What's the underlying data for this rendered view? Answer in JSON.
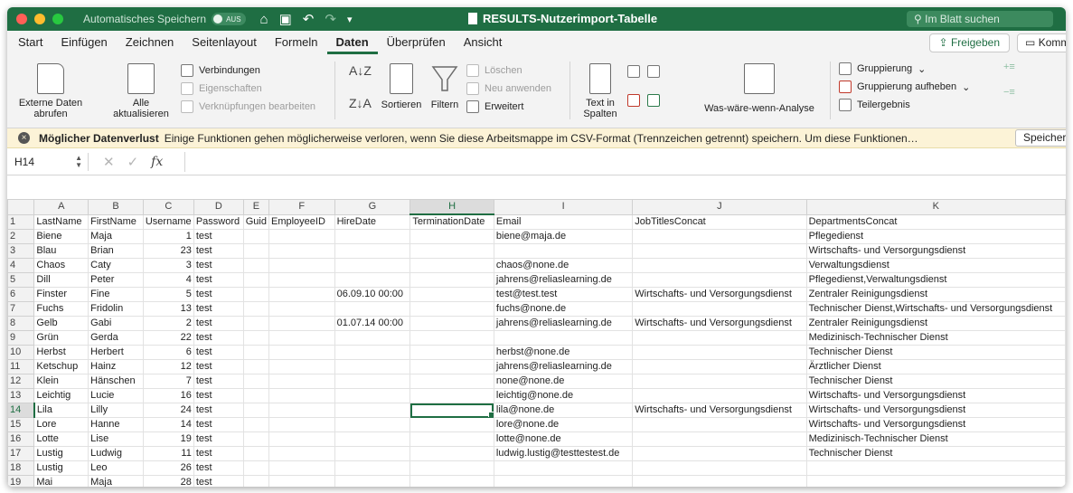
{
  "window": {
    "autosave_label": "Automatisches Speichern",
    "autosave_state": "AUS",
    "title": "RESULTS-Nutzerimport-Tabelle",
    "search_placeholder": "Im Blatt suchen"
  },
  "tabs": [
    "Start",
    "Einfügen",
    "Zeichnen",
    "Seitenlayout",
    "Formeln",
    "Daten",
    "Überprüfen",
    "Ansicht"
  ],
  "active_tab": "Daten",
  "share_label": "Freigeben",
  "comment_label": "Kommentare",
  "ribbon": {
    "external_data": "Externe Daten abrufen",
    "refresh_all": "Alle aktualisieren",
    "connections": "Verbindungen",
    "properties": "Eigenschaften",
    "edit_links": "Verknüpfungen bearbeiten",
    "sort": "Sortieren",
    "filter": "Filtern",
    "clear": "Löschen",
    "reapply": "Neu anwenden",
    "advanced": "Erweitert",
    "text_to_columns": "Text in Spalten",
    "what_if": "Was-wäre-wenn-Analyse",
    "group": "Gruppierung",
    "ungroup": "Gruppierung aufheben",
    "subtotal": "Teilergebnis"
  },
  "message": {
    "title": "Möglicher Datenverlust",
    "text": "Einige Funktionen gehen möglicherweise verloren, wenn Sie diese Arbeitsmappe im CSV-Format (Trennzeichen getrennt) speichern. Um diese Funktionen…",
    "save_button": "Speichern unter"
  },
  "formula_bar": {
    "name_box": "H14",
    "fx": "fx",
    "value": ""
  },
  "grid": {
    "columns": [
      "A",
      "B",
      "C",
      "D",
      "E",
      "F",
      "G",
      "H",
      "I",
      "J",
      "K"
    ],
    "selected_column": "H",
    "selected_row": 14,
    "rows": [
      {
        "n": "1",
        "cells": [
          "LastName",
          "FirstName",
          "Username",
          "Password",
          "Guid",
          "EmployeeID",
          "HireDate",
          "TerminationDate",
          "Email",
          "JobTitlesConcat",
          "DepartmentsConcat"
        ]
      },
      {
        "n": "2",
        "cells": [
          "Biene",
          "Maja",
          "1",
          "test",
          "",
          "",
          "",
          "",
          "biene@maja.de",
          "",
          "Pflegedienst"
        ]
      },
      {
        "n": "3",
        "cells": [
          "Blau",
          "Brian",
          "23",
          "test",
          "",
          "",
          "",
          "",
          "",
          "",
          "Wirtschafts- und Versorgungsdienst"
        ]
      },
      {
        "n": "4",
        "cells": [
          "Chaos",
          "Caty",
          "3",
          "test",
          "",
          "",
          "",
          "",
          "chaos@none.de",
          "",
          "Verwaltungsdienst"
        ]
      },
      {
        "n": "5",
        "cells": [
          "Dill",
          "Peter",
          "4",
          "test",
          "",
          "",
          "",
          "",
          "jahrens@reliaslearning.de",
          "",
          "Pflegedienst,Verwaltungsdienst"
        ]
      },
      {
        "n": "6",
        "cells": [
          "Finster",
          "Fine",
          "5",
          "test",
          "",
          "",
          "06.09.10 00:00",
          "",
          "test@test.test",
          "Wirtschafts- und Versorgungsdienst",
          "Zentraler Reinigungsdienst"
        ]
      },
      {
        "n": "7",
        "cells": [
          "Fuchs",
          "Fridolin",
          "13",
          "test",
          "",
          "",
          "",
          "",
          "fuchs@none.de",
          "",
          "Technischer Dienst,Wirtschafts- und Versorgungsdienst"
        ]
      },
      {
        "n": "8",
        "cells": [
          "Gelb",
          "Gabi",
          "2",
          "test",
          "",
          "",
          "01.07.14 00:00",
          "",
          "jahrens@reliaslearning.de",
          "Wirtschafts- und Versorgungsdienst",
          "Zentraler Reinigungsdienst"
        ]
      },
      {
        "n": "9",
        "cells": [
          "Grün",
          "Gerda",
          "22",
          "test",
          "",
          "",
          "",
          "",
          "",
          "",
          "Medizinisch-Technischer Dienst"
        ]
      },
      {
        "n": "10",
        "cells": [
          "Herbst",
          "Herbert",
          "6",
          "test",
          "",
          "",
          "",
          "",
          "herbst@none.de",
          "",
          "Technischer Dienst"
        ]
      },
      {
        "n": "11",
        "cells": [
          "Ketschup",
          "Hainz",
          "12",
          "test",
          "",
          "",
          "",
          "",
          "jahrens@reliaslearning.de",
          "",
          "Ärztlicher Dienst"
        ]
      },
      {
        "n": "12",
        "cells": [
          "Klein",
          "Hänschen",
          "7",
          "test",
          "",
          "",
          "",
          "",
          "none@none.de",
          "",
          "Technischer Dienst"
        ]
      },
      {
        "n": "13",
        "cells": [
          "Leichtig",
          "Lucie",
          "16",
          "test",
          "",
          "",
          "",
          "",
          "leichtig@none.de",
          "",
          "Wirtschafts- und Versorgungsdienst"
        ]
      },
      {
        "n": "14",
        "cells": [
          "Lila",
          "Lilly",
          "24",
          "test",
          "",
          "",
          "",
          "",
          "lila@none.de",
          "Wirtschafts- und Versorgungsdienst",
          "Wirtschafts- und Versorgungsdienst"
        ]
      },
      {
        "n": "15",
        "cells": [
          "Lore",
          "Hanne",
          "14",
          "test",
          "",
          "",
          "",
          "",
          "lore@none.de",
          "",
          "Wirtschafts- und Versorgungsdienst"
        ]
      },
      {
        "n": "16",
        "cells": [
          "Lotte",
          "Lise",
          "19",
          "test",
          "",
          "",
          "",
          "",
          "lotte@none.de",
          "",
          "Medizinisch-Technischer Dienst"
        ]
      },
      {
        "n": "17",
        "cells": [
          "Lustig",
          "Ludwig",
          "11",
          "test",
          "",
          "",
          "",
          "",
          "ludwig.lustig@testtestest.de",
          "",
          "Technischer Dienst"
        ]
      },
      {
        "n": "18",
        "cells": [
          "Lustig",
          "Leo",
          "26",
          "test",
          "",
          "",
          "",
          "",
          "",
          "",
          ""
        ]
      },
      {
        "n": "19",
        "cells": [
          "Mai",
          "Maja",
          "28",
          "test",
          "",
          "",
          "",
          "",
          "",
          "",
          ""
        ]
      }
    ]
  },
  "colors": {
    "accent": "#1f6e43",
    "message_bg": "#fcf3d7"
  }
}
